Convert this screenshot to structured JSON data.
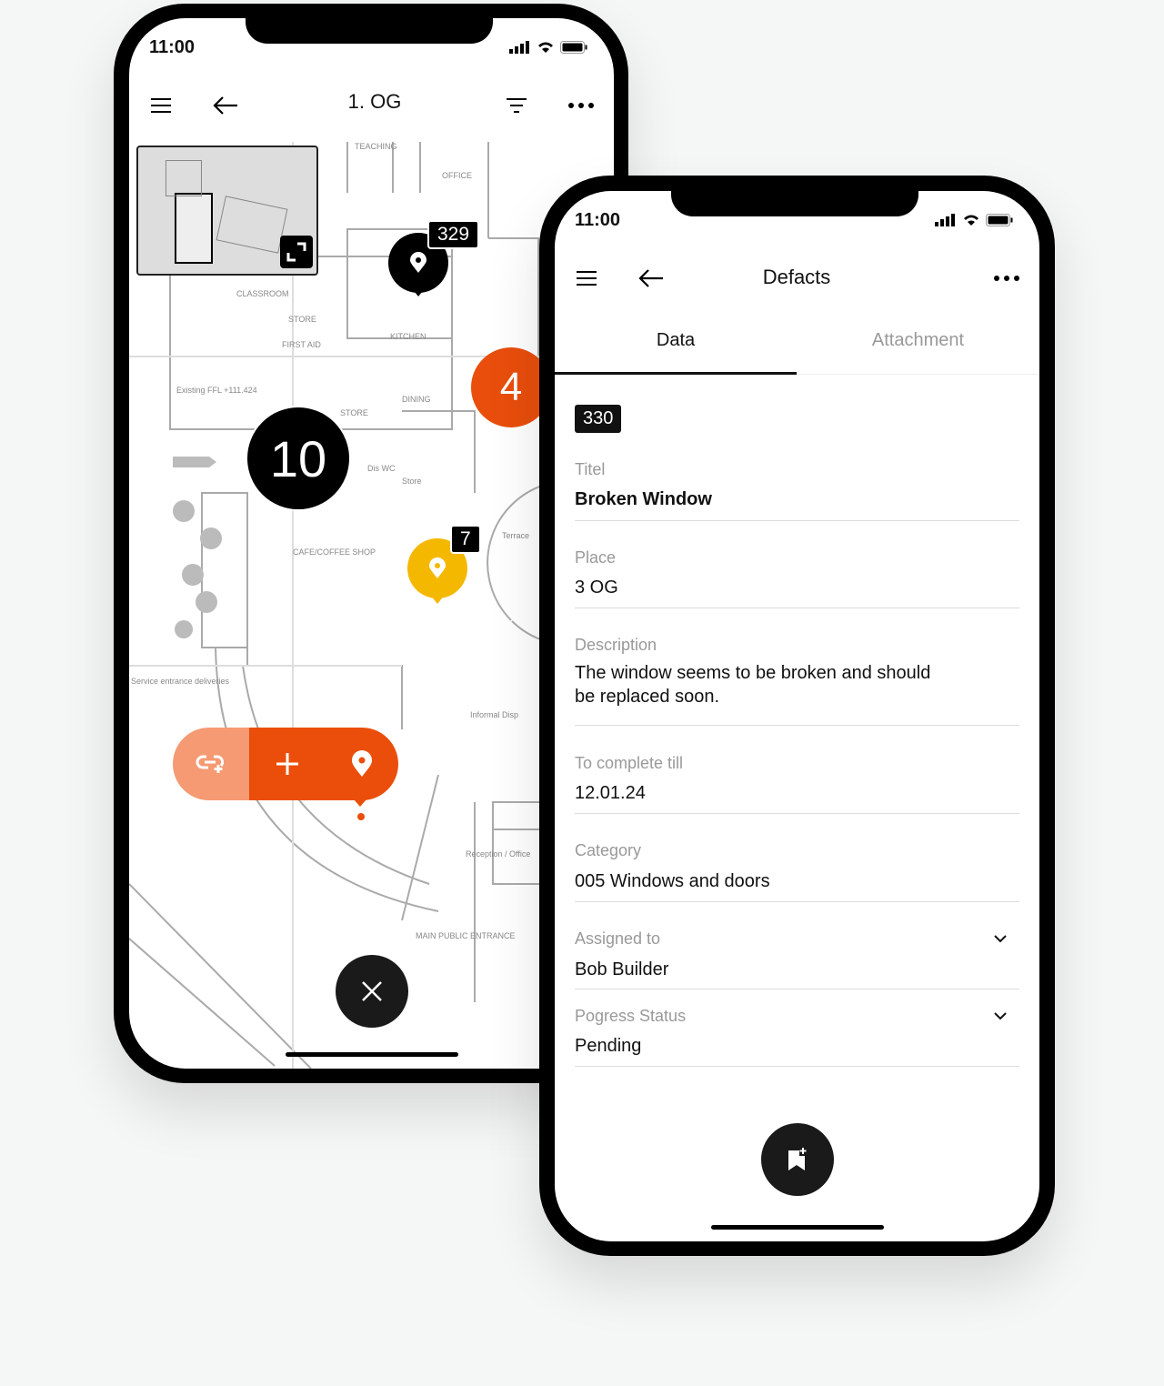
{
  "map_phone": {
    "time": "11:00",
    "title": "1. OG",
    "markers": [
      {
        "count": "10"
      },
      {
        "count": "4",
        "color": "#e94e0c"
      }
    ],
    "pins": [
      {
        "id": "329",
        "color": "#000000"
      },
      {
        "id": "7",
        "color": "#f5b800"
      }
    ],
    "plan_labels": [
      "CLASSROOM",
      "STORE",
      "FIRST AID",
      "KITCHEN",
      "DINING",
      "STORE",
      "CAFE/COFFEE SHOP",
      "Terrace",
      "Existing FFL +111.424",
      "Service entrance deliveries",
      "Dis WC",
      "Store",
      "Reception / Office",
      "MAIN PUBLIC ENTRANCE",
      "Informal Disp",
      "TEACHING",
      "OFFICE"
    ],
    "toolbar_colors": {
      "light": "#f59a72",
      "main": "#ea4e0a"
    }
  },
  "detail_phone": {
    "time": "11:00",
    "title": "Defacts",
    "tabs": [
      {
        "label": "Data",
        "active": true
      },
      {
        "label": "Attachment",
        "active": false
      }
    ],
    "id_badge": "330",
    "fields": [
      {
        "label": "Titel",
        "value": "Broken Window"
      },
      {
        "label": "Place",
        "value": "3 OG"
      },
      {
        "label": "Description",
        "value": "The window seems to be broken and should be replaced soon."
      },
      {
        "label": "To complete till",
        "value": "12.01.24"
      },
      {
        "label": "Category",
        "value": "005 Windows and doors"
      },
      {
        "label": "Assigned to",
        "value": "Bob Builder",
        "dropdown": true
      },
      {
        "label": "Pogress Status",
        "value": "Pending",
        "dropdown": true
      }
    ]
  }
}
